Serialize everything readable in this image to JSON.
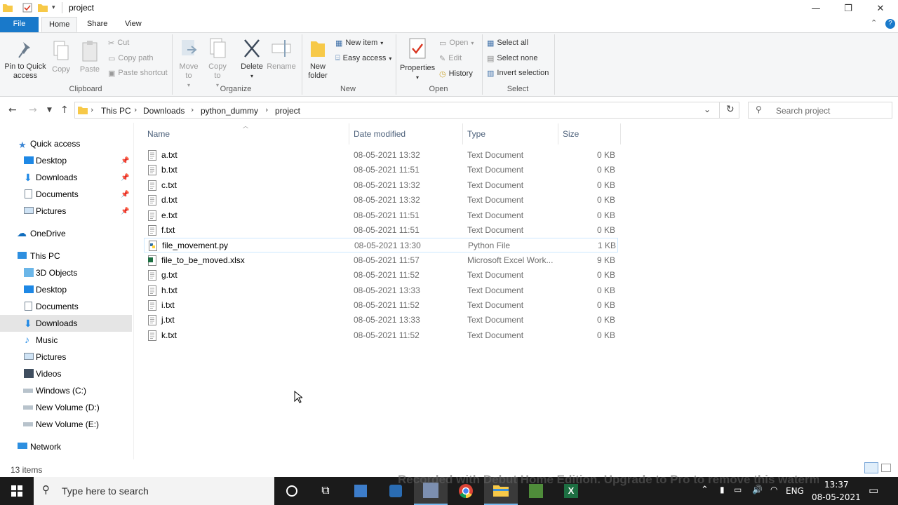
{
  "window": {
    "title": "project"
  },
  "ribbon_tabs": [
    "File",
    "Home",
    "Share",
    "View"
  ],
  "ribbon": {
    "clipboard": {
      "pin": "Pin to Quick access",
      "copy": "Copy",
      "paste": "Paste",
      "cut": "Cut",
      "copy_path": "Copy path",
      "paste_shortcut": "Paste shortcut",
      "label": "Clipboard"
    },
    "organize": {
      "move_to": "Move to",
      "copy_to": "Copy to",
      "delete": "Delete",
      "rename": "Rename",
      "label": "Organize"
    },
    "new": {
      "new_folder": "New folder",
      "new_item": "New item",
      "easy_access": "Easy access",
      "label": "New"
    },
    "open": {
      "properties": "Properties",
      "open": "Open",
      "edit": "Edit",
      "history": "History",
      "label": "Open"
    },
    "select": {
      "select_all": "Select all",
      "select_none": "Select none",
      "invert": "Invert selection",
      "label": "Select"
    }
  },
  "address": {
    "crumbs": [
      "This PC",
      "Downloads",
      "python_dummy",
      "project"
    ]
  },
  "search": {
    "placeholder": "Search project"
  },
  "nav": {
    "quick_access": "Quick access",
    "quick_items": [
      "Desktop",
      "Downloads",
      "Documents",
      "Pictures"
    ],
    "onedrive": "OneDrive",
    "this_pc": "This PC",
    "pc_items": [
      "3D Objects",
      "Desktop",
      "Documents",
      "Downloads",
      "Music",
      "Pictures",
      "Videos",
      "Windows (C:)",
      "New Volume (D:)",
      "New Volume (E:)"
    ],
    "network": "Network"
  },
  "columns": {
    "name": "Name",
    "date": "Date modified",
    "type": "Type",
    "size": "Size"
  },
  "files": [
    {
      "name": "a.txt",
      "date": "08-05-2021 13:32",
      "type": "Text Document",
      "size": "0 KB",
      "icon": "text-file-icon"
    },
    {
      "name": "b.txt",
      "date": "08-05-2021 11:51",
      "type": "Text Document",
      "size": "0 KB",
      "icon": "text-file-icon"
    },
    {
      "name": "c.txt",
      "date": "08-05-2021 13:32",
      "type": "Text Document",
      "size": "0 KB",
      "icon": "text-file-icon"
    },
    {
      "name": "d.txt",
      "date": "08-05-2021 13:32",
      "type": "Text Document",
      "size": "0 KB",
      "icon": "text-file-icon"
    },
    {
      "name": "e.txt",
      "date": "08-05-2021 11:51",
      "type": "Text Document",
      "size": "0 KB",
      "icon": "text-file-icon"
    },
    {
      "name": "f.txt",
      "date": "08-05-2021 11:51",
      "type": "Text Document",
      "size": "0 KB",
      "icon": "text-file-icon"
    },
    {
      "name": "file_movement.py",
      "date": "08-05-2021 13:30",
      "type": "Python File",
      "size": "1 KB",
      "icon": "python-file-icon"
    },
    {
      "name": "file_to_be_moved.xlsx",
      "date": "08-05-2021 11:57",
      "type": "Microsoft Excel Work...",
      "size": "9 KB",
      "icon": "excel-file-icon"
    },
    {
      "name": "g.txt",
      "date": "08-05-2021 11:52",
      "type": "Text Document",
      "size": "0 KB",
      "icon": "text-file-icon"
    },
    {
      "name": "h.txt",
      "date": "08-05-2021 13:33",
      "type": "Text Document",
      "size": "0 KB",
      "icon": "text-file-icon"
    },
    {
      "name": "i.txt",
      "date": "08-05-2021 11:52",
      "type": "Text Document",
      "size": "0 KB",
      "icon": "text-file-icon"
    },
    {
      "name": "j.txt",
      "date": "08-05-2021 13:33",
      "type": "Text Document",
      "size": "0 KB",
      "icon": "text-file-icon"
    },
    {
      "name": "k.txt",
      "date": "08-05-2021 11:52",
      "type": "Text Document",
      "size": "0 KB",
      "icon": "text-file-icon"
    }
  ],
  "status": {
    "items": "13 items"
  },
  "taskbar": {
    "search_placeholder": "Type here to search",
    "lang": "ENG",
    "time": "13:37",
    "date": "08-05-2021"
  },
  "watermark": "Recorded with Debut Home Edition. Upgrade to Pro to remove this watermark",
  "colors": {
    "accent": "#1979ca",
    "selected_nav": "#e5e5e5",
    "taskbar": "#1b1b1b"
  }
}
